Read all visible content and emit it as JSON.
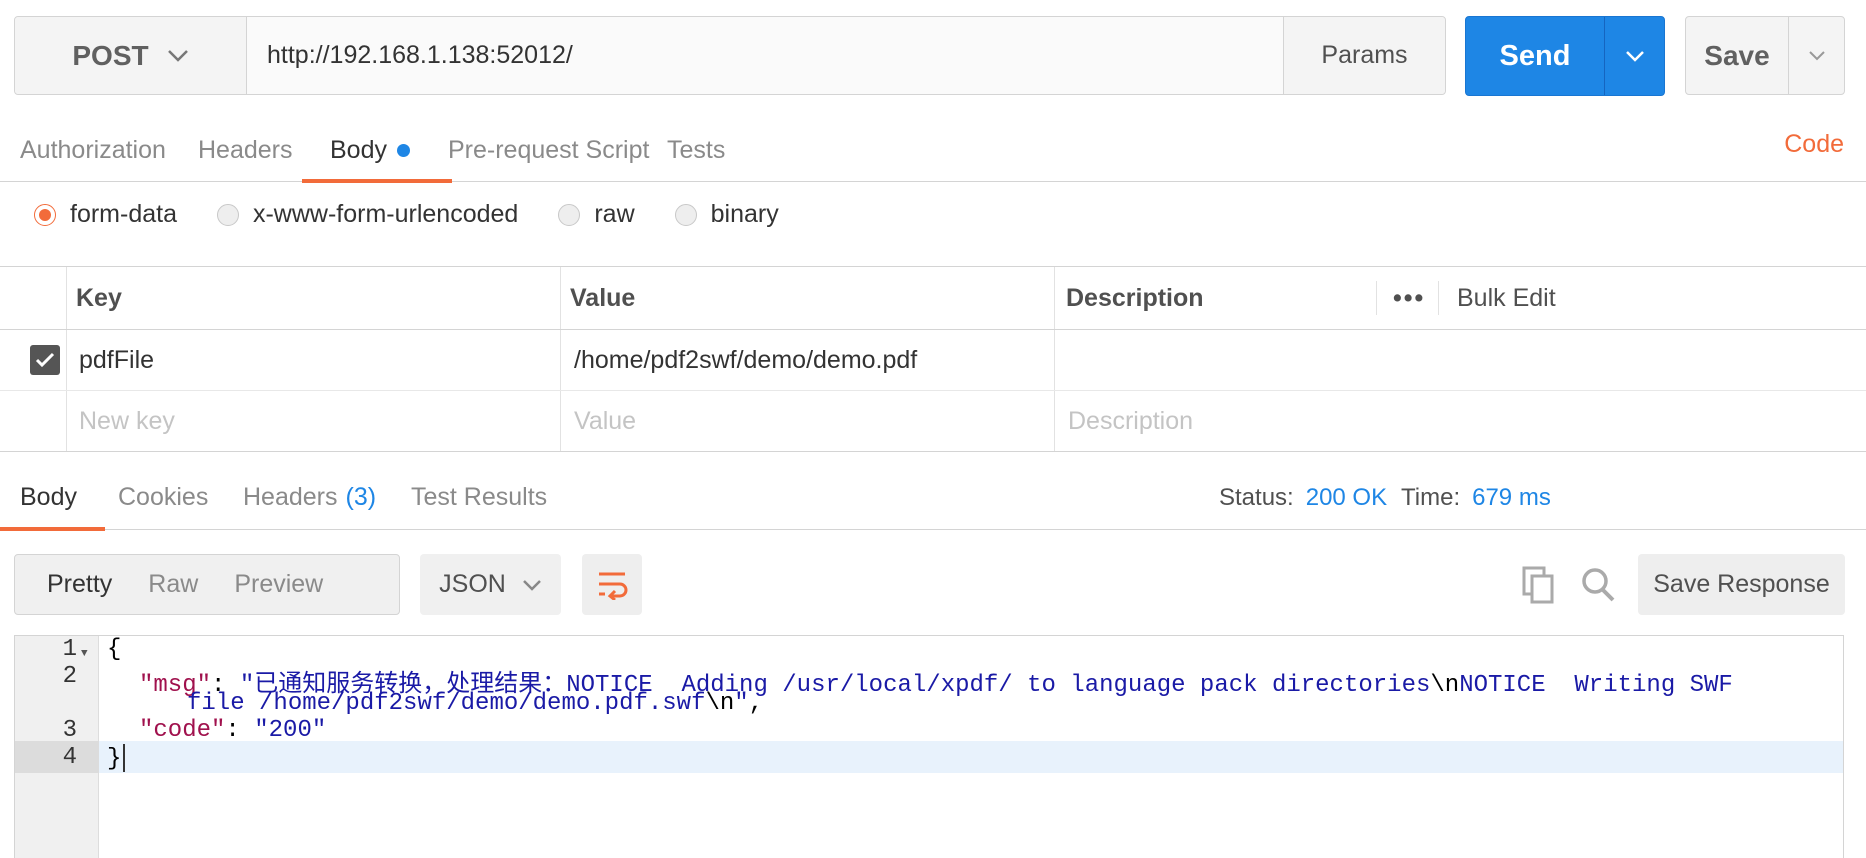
{
  "request": {
    "method": "POST",
    "url": "http://192.168.1.138:52012/",
    "params_label": "Params",
    "send_label": "Send",
    "save_label": "Save"
  },
  "request_tabs": {
    "authorization": "Authorization",
    "headers": "Headers",
    "body": "Body",
    "prerequest": "Pre-request Script",
    "tests": "Tests",
    "code": "Code"
  },
  "body_types": {
    "form_data": "form-data",
    "urlencoded": "x-www-form-urlencoded",
    "raw": "raw",
    "binary": "binary"
  },
  "kv_table": {
    "headers": {
      "key": "Key",
      "value": "Value",
      "description": "Description",
      "more": "•••",
      "bulk_edit": "Bulk Edit"
    },
    "rows": [
      {
        "key": "pdfFile",
        "value": "/home/pdf2swf/demo/demo.pdf",
        "description": ""
      }
    ],
    "placeholders": {
      "key": "New key",
      "value": "Value",
      "description": "Description"
    }
  },
  "response_tabs": {
    "body": "Body",
    "cookies": "Cookies",
    "headers": "Headers",
    "headers_count": "(3)",
    "test_results": "Test Results"
  },
  "response_meta": {
    "status_label": "Status:",
    "status_value": "200 OK",
    "time_label": "Time:",
    "time_value": "679 ms"
  },
  "response_toolbar": {
    "pretty": "Pretty",
    "raw": "Raw",
    "preview": "Preview",
    "format": "JSON",
    "save_response": "Save Response"
  },
  "editor": {
    "line_numbers": [
      "1",
      "2",
      "3",
      "4"
    ],
    "open_brace": "{",
    "close_brace": "}",
    "msg_key": "\"msg\"",
    "msg_part1": "\"已通知服务转换，处理结果：NOTICE  Adding /usr/local/xpdf/ to language pack directories",
    "esc1": "\\n",
    "msg_part2": "NOTICE  Writing SWF",
    "msg_part3": "file /home/pdf2swf/demo/demo.pdf.swf",
    "esc2": "\\n",
    "msg_end": "\"",
    "code_key": "\"code\"",
    "code_value": "\"200\""
  },
  "colors": {
    "accent": "#f26b3a",
    "primary": "#1e86e5",
    "json_key": "#a0114d",
    "json_string": "#1a1aa6"
  }
}
